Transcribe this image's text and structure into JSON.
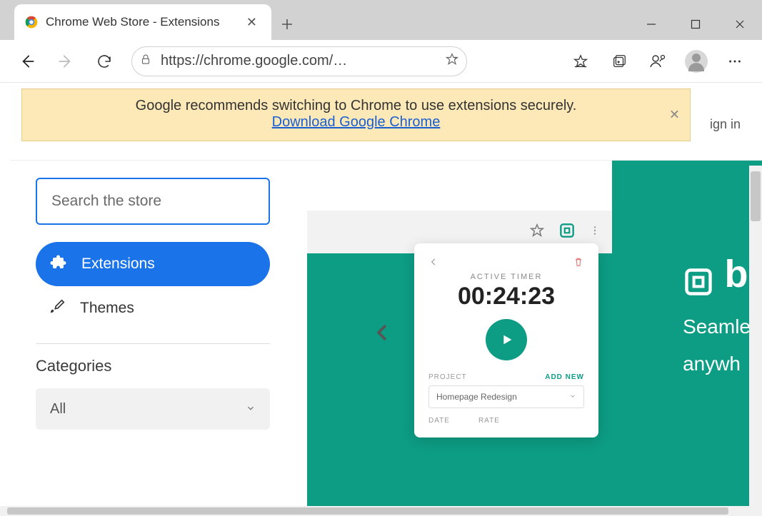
{
  "tab": {
    "title": "Chrome Web Store - Extensions"
  },
  "address": {
    "url": "https://chrome.google.com/…"
  },
  "banner": {
    "message": "Google recommends switching to Chrome to use extensions securely.",
    "link": "Download Google Chrome"
  },
  "header": {
    "signin": "ign in"
  },
  "sidebar": {
    "search_placeholder": "Search the store",
    "extensions_label": "Extensions",
    "themes_label": "Themes",
    "categories_title": "Categories",
    "category_selected": "All"
  },
  "promo": {
    "brand_letter": "b",
    "line1": "Seamle",
    "line2": "anywh",
    "timer_label": "ACTIVE TIMER",
    "timer_value": "00:24:23",
    "project_label": "PROJECT",
    "add_new": "ADD NEW",
    "project_value": "Homepage Redesign",
    "date_label": "DATE",
    "rate_label": "RATE"
  }
}
